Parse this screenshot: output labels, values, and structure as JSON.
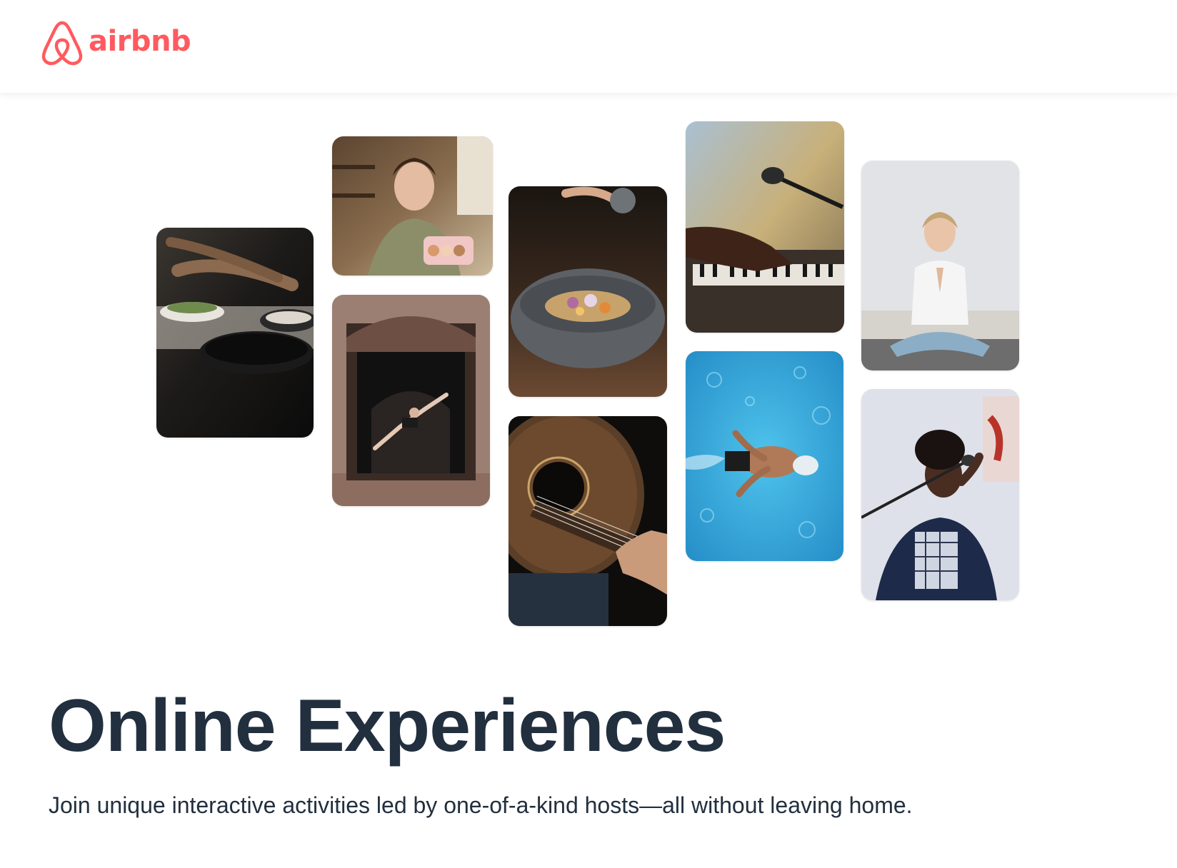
{
  "brand": {
    "name": "airbnb",
    "color": "#ff5a5f"
  },
  "collage": {
    "tiles": [
      {
        "id": "cooking",
        "alt": "Hands cooking with pans on a stove"
      },
      {
        "id": "pastry-chef",
        "alt": "Woman holding a box of macarons"
      },
      {
        "id": "dancer",
        "alt": "Dancer leaping in an ornate doorway"
      },
      {
        "id": "food-bowl",
        "alt": "Seasoning sprinkled over a stone bowl of food"
      },
      {
        "id": "guitar",
        "alt": "Hands playing an acoustic guitar"
      },
      {
        "id": "piano",
        "alt": "Hands playing a keyboard with microphone"
      },
      {
        "id": "swimmer",
        "alt": "Swimmer in a blue pool"
      },
      {
        "id": "yoga",
        "alt": "Woman meditating in lotus pose"
      },
      {
        "id": "singer",
        "alt": "Woman singing into a microphone"
      }
    ]
  },
  "hero": {
    "title": "Online Experiences",
    "subtitle": "Join unique interactive activities led by one-of-a-kind hosts—all without leaving home."
  },
  "colors": {
    "heading": "#222f3e",
    "background": "#ffffff"
  }
}
